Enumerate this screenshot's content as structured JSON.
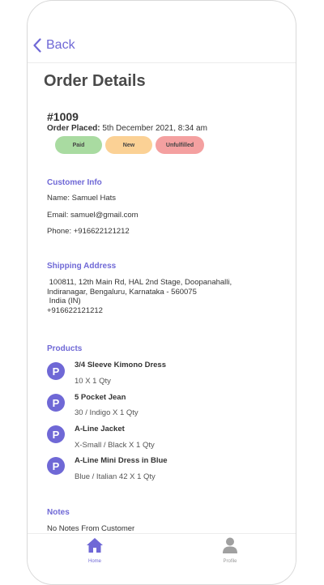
{
  "nav": {
    "back_label": "Back"
  },
  "page": {
    "title": "Order Details"
  },
  "order": {
    "number": "#1009",
    "placed_label": "Order Placed:",
    "placed_value": "5th December 2021, 8:34 am",
    "badges": [
      {
        "label": "Paid",
        "color": "#a9dba1"
      },
      {
        "label": "New",
        "color": "#fbd195"
      },
      {
        "label": "Unfulfilled",
        "color": "#f4a0a0"
      }
    ]
  },
  "customer": {
    "heading": "Customer Info",
    "name": "Name: Samuel Hats",
    "email": "Email: samuel@gmail.com",
    "phone": "Phone: +916622121212"
  },
  "shipping": {
    "heading": "Shipping Address",
    "lines": [
      " 100811, 12th Main Rd, HAL 2nd Stage, Doopanahalli,",
      "Indiranagar, Bengaluru, Karnataka - 560075",
      " India (IN)",
      "+916622121212"
    ]
  },
  "products": {
    "heading": "Products",
    "icon_letter": "P",
    "items": [
      {
        "name": "3/4 Sleeve Kimono Dress",
        "detail": "10 X 1 Qty"
      },
      {
        "name": "5 Pocket Jean",
        "detail": "30 / Indigo X 1 Qty"
      },
      {
        "name": "A-Line Jacket",
        "detail": "X-Small / Black X 1 Qty"
      },
      {
        "name": "A-Line Mini Dress in Blue",
        "detail": "Blue / Italian 42 X 1 Qty"
      }
    ]
  },
  "notes": {
    "heading": "Notes",
    "text": "No Notes From Customer"
  },
  "tabbar": {
    "home_label": "Home",
    "home_icon": "home-icon",
    "profile_label": "Profile",
    "profile_icon": "person-icon"
  },
  "colors": {
    "accent": "#6f68d6"
  }
}
